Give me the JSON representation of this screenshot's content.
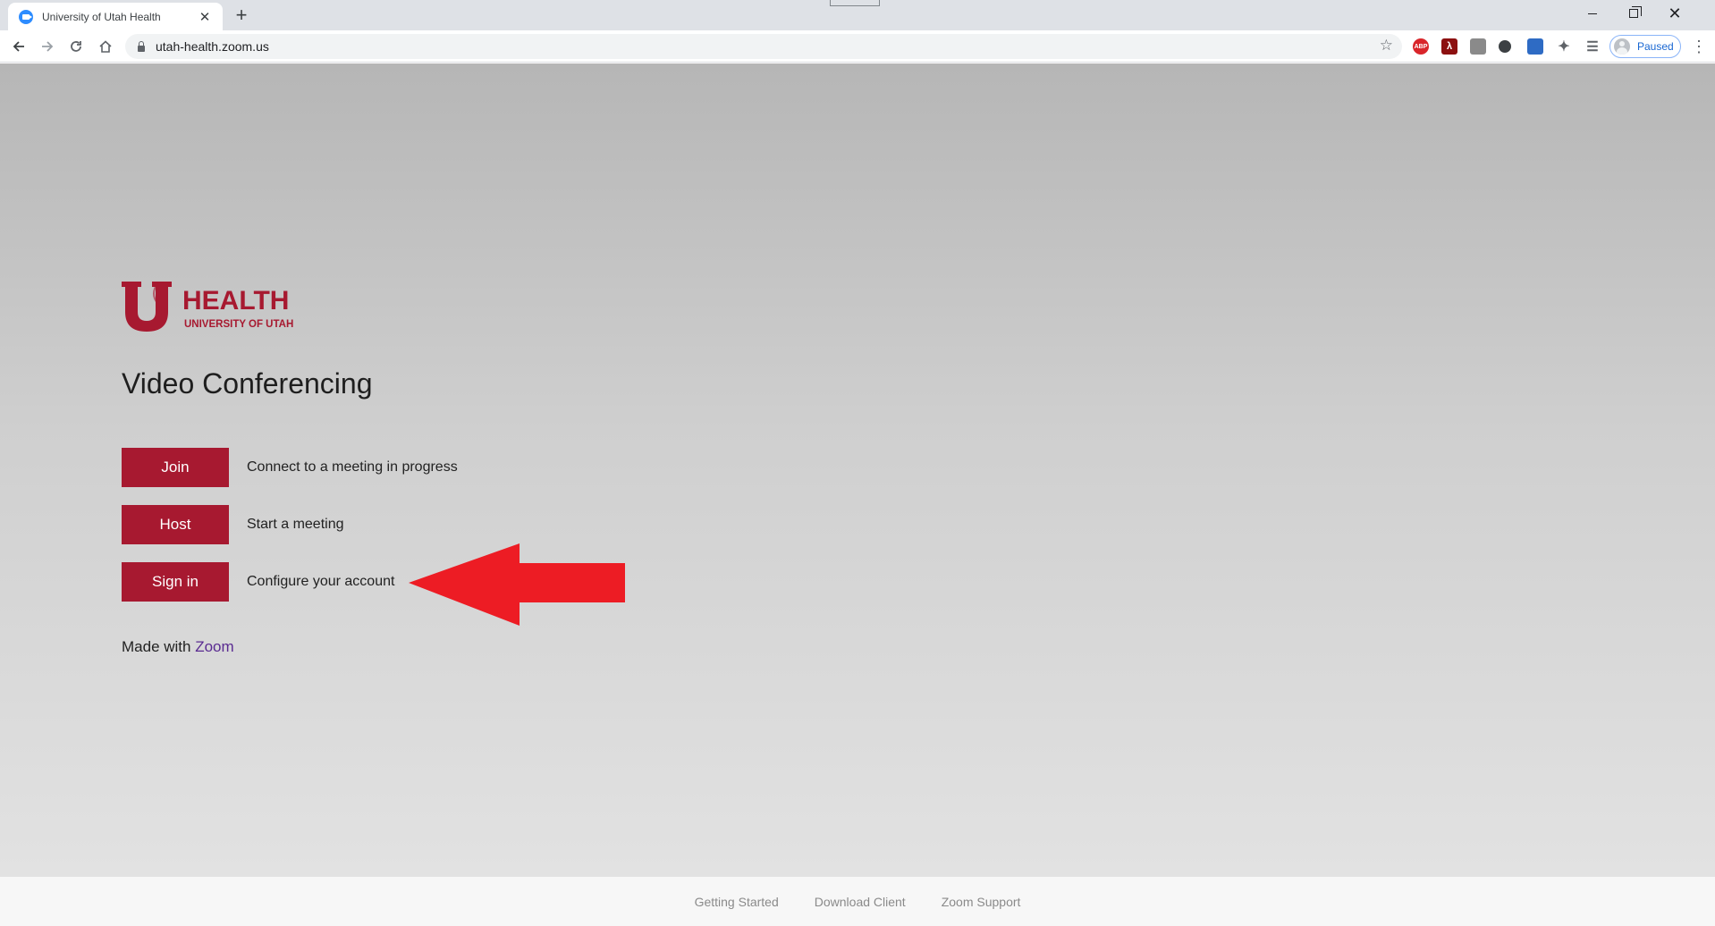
{
  "browser": {
    "tab_title": "University of Utah Health",
    "new_tab_symbol": "+",
    "tab_close_symbol": "✕",
    "url": "utah-health.zoom.us",
    "profile_status": "Paused",
    "extensions": [
      "adblock-plus",
      "adobe-acrobat",
      "extension-3",
      "extension-4",
      "extension-5"
    ]
  },
  "logo": {
    "main_text": "HEALTH",
    "sub_text": "UNIVERSITY OF UTAH",
    "color": "#a71930"
  },
  "main": {
    "title": "Video Conferencing",
    "actions": [
      {
        "label": "Join",
        "description": "Connect to a meeting in progress"
      },
      {
        "label": "Host",
        "description": "Start a meeting"
      },
      {
        "label": "Sign in",
        "description": "Configure your account"
      }
    ],
    "made_with_prefix": "Made with",
    "made_with_link": "Zoom"
  },
  "annotation": {
    "arrow_color": "#ed1c24"
  },
  "footer": {
    "links": [
      "Getting Started",
      "Download Client",
      "Zoom Support"
    ]
  },
  "colors": {
    "button_bg": "#a71930",
    "link": "#5a2b91"
  }
}
